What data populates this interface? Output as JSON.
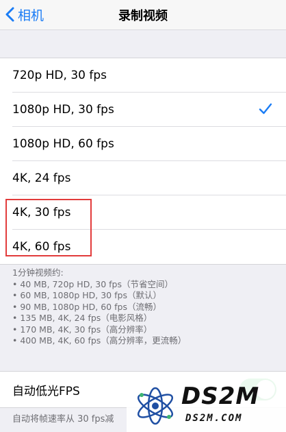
{
  "nav": {
    "back_label": "相机",
    "title": "录制视频"
  },
  "video_options": [
    {
      "label": "720p HD, 30 fps",
      "selected": false
    },
    {
      "label": "1080p HD, 30 fps",
      "selected": true
    },
    {
      "label": "1080p HD, 60 fps",
      "selected": false
    },
    {
      "label": "4K, 24 fps",
      "selected": false
    },
    {
      "label": "4K, 30 fps",
      "selected": false
    },
    {
      "label": "4K, 60 fps",
      "selected": false
    }
  ],
  "footnote": {
    "heading": "1分钟视频约:",
    "lines": [
      "• 40 MB, 720p HD, 30 fps（节省空间）",
      "• 60 MB, 1080p HD, 30 fps（默认）",
      "• 90 MB, 1080p HD, 60 fps（流畅）",
      "• 135 MB, 4K, 24 fps（电影风格）",
      "• 170 MB, 4K, 30 fps（高分辨率）",
      "• 400 MB, 4K, 60 fps（高分辨率，更流畅）"
    ]
  },
  "low_light": {
    "label": "自动低光FPS",
    "enabled": true,
    "description": "自动将帧速率从 30 fps减"
  },
  "watermark": {
    "big_text": "DS2M",
    "small_text": "DS2M.COM"
  },
  "colors": {
    "accent": "#1a7cf5",
    "toggle_on": "#34c759",
    "highlight_box": "#e23b3b"
  }
}
